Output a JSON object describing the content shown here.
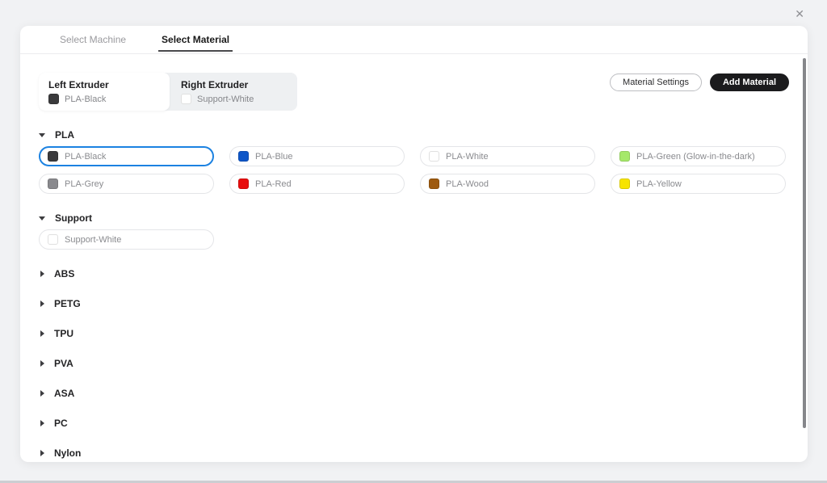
{
  "window": {
    "close_icon": "✕"
  },
  "tabs": [
    {
      "label": "Select Machine",
      "active": false
    },
    {
      "label": "Select Material",
      "active": true
    }
  ],
  "extruders": {
    "left": {
      "title": "Left Extruder",
      "material": "PLA-Black",
      "swatch": "#3a3a3c"
    },
    "right": {
      "title": "Right Extruder",
      "material": "Support-White",
      "swatch": "#ffffff"
    }
  },
  "toolbar": {
    "material_settings_label": "Material Settings",
    "add_material_label": "Add Material"
  },
  "colors": {
    "selected_chip_border": "#1c82e1",
    "add_button_bg": "#1b1b1d"
  },
  "sections": [
    {
      "name": "PLA",
      "expanded": true,
      "materials": [
        {
          "label": "PLA-Black",
          "color": "#3a3a3c",
          "selected": true
        },
        {
          "label": "PLA-Blue",
          "color": "#0e56c8",
          "selected": false
        },
        {
          "label": "PLA-White",
          "color": "#ffffff",
          "selected": false
        },
        {
          "label": "PLA-Green (Glow-in-the-dark)",
          "color": "#a5e86a",
          "selected": false
        },
        {
          "label": "PLA-Grey",
          "color": "#89898d",
          "selected": false
        },
        {
          "label": "PLA-Red",
          "color": "#e80d0d",
          "selected": false
        },
        {
          "label": "PLA-Wood",
          "color": "#9e5a0f",
          "selected": false
        },
        {
          "label": "PLA-Yellow",
          "color": "#f7e400",
          "selected": false
        }
      ]
    },
    {
      "name": "Support",
      "expanded": true,
      "materials": [
        {
          "label": "Support-White",
          "color": "#ffffff",
          "selected": false
        }
      ]
    },
    {
      "name": "ABS",
      "expanded": false,
      "materials": []
    },
    {
      "name": "PETG",
      "expanded": false,
      "materials": []
    },
    {
      "name": "TPU",
      "expanded": false,
      "materials": []
    },
    {
      "name": "PVA",
      "expanded": false,
      "materials": []
    },
    {
      "name": "ASA",
      "expanded": false,
      "materials": []
    },
    {
      "name": "PC",
      "expanded": false,
      "materials": []
    },
    {
      "name": "Nylon",
      "expanded": false,
      "materials": []
    }
  ]
}
